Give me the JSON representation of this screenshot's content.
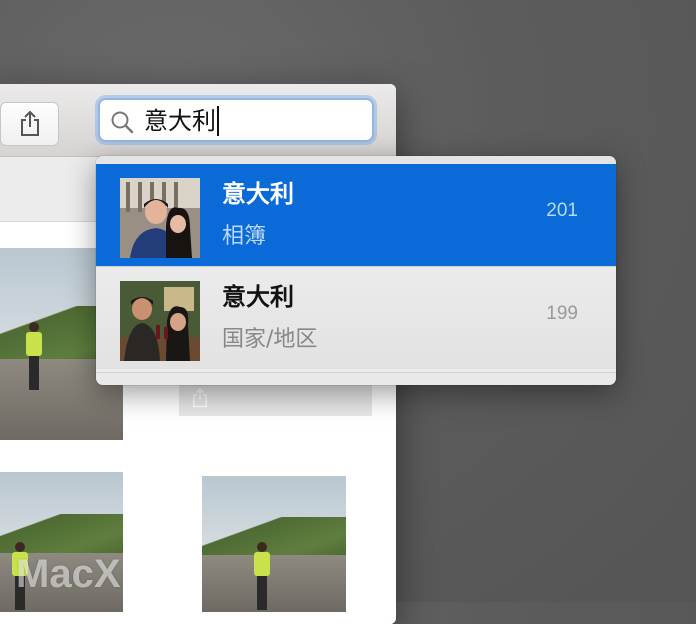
{
  "toolbar": {
    "share_icon": "share-icon",
    "search": {
      "value": "意大利",
      "icon": "magnifier-icon"
    }
  },
  "suggestions": [
    {
      "title": "意大利",
      "subtitle": "相簿",
      "count": "201",
      "selected": true,
      "thumb": "couple-photo"
    },
    {
      "title": "意大利",
      "subtitle": "国家/地区",
      "count": "199",
      "selected": false,
      "thumb": "dinner-photo"
    }
  ],
  "watermark": "MacX",
  "colors": {
    "selection": "#0a6ad7",
    "focus_ring": "#8fb8e8",
    "desktop": "#5c5c5c"
  }
}
